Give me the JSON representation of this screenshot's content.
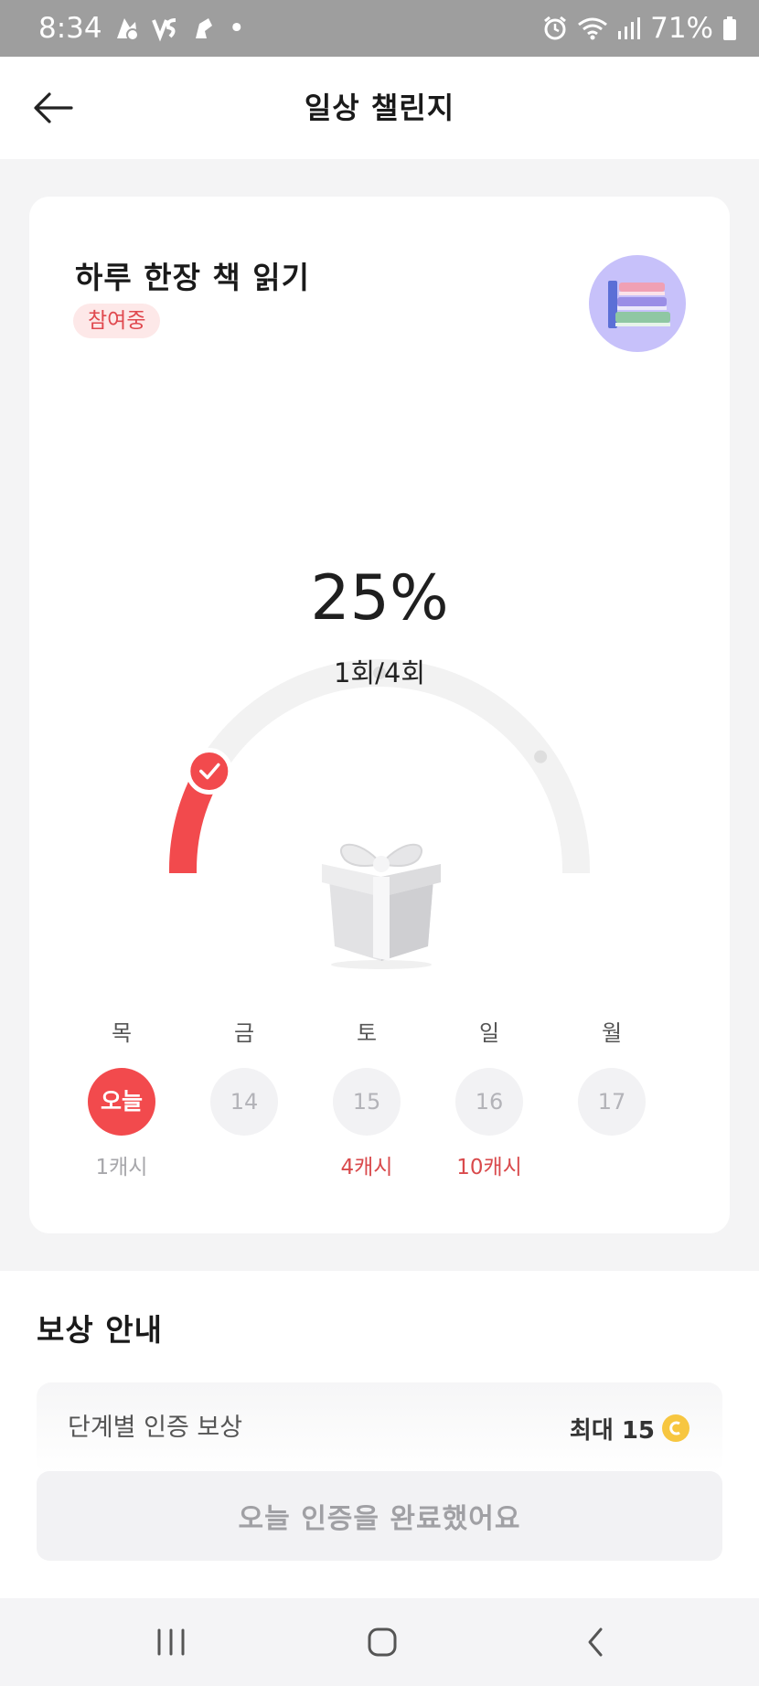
{
  "status_bar": {
    "time": "8:34",
    "notification_dot": "•",
    "battery": "71%",
    "icons": [
      "app-notification-icon",
      "vpn-icon",
      "app-notification-icon",
      "alarm-icon",
      "wifi-icon",
      "signal-icon",
      "battery-icon"
    ]
  },
  "header": {
    "title": "일상 챌린지",
    "back_icon": "back-arrow-icon"
  },
  "challenge": {
    "title": "하루 한장 책 읽기",
    "status": "참여중",
    "image_icon": "books-icon",
    "progress": {
      "percent_label": "25%",
      "count_label": "1회/4회",
      "fraction": 0.25,
      "completed": 1,
      "total": 4
    },
    "reward_icon": "gift-icon",
    "days": [
      {
        "weekday": "목",
        "label": "오늘",
        "reward": "1캐시",
        "today": true
      },
      {
        "weekday": "금",
        "label": "14",
        "reward": "",
        "today": false
      },
      {
        "weekday": "토",
        "label": "15",
        "reward": "4캐시",
        "today": false
      },
      {
        "weekday": "일",
        "label": "16",
        "reward": "10캐시",
        "today": false
      },
      {
        "weekday": "월",
        "label": "17",
        "reward": "",
        "today": false
      }
    ]
  },
  "reward_info": {
    "heading": "보상 안내",
    "row_label": "단계별 인증 보상",
    "row_value": "최대 15",
    "coin_icon": "coin-icon"
  },
  "complete_button": "오늘 인증을 완료했어요",
  "colors": {
    "accent": "#f24a4d",
    "badge_bg": "#fde8e8",
    "avatar_bg": "#c7c1fa",
    "track": "#f2f2f2",
    "coin": "#f7c640"
  },
  "nav": {
    "icons": [
      "recent-apps-icon",
      "home-icon",
      "back-icon"
    ]
  }
}
